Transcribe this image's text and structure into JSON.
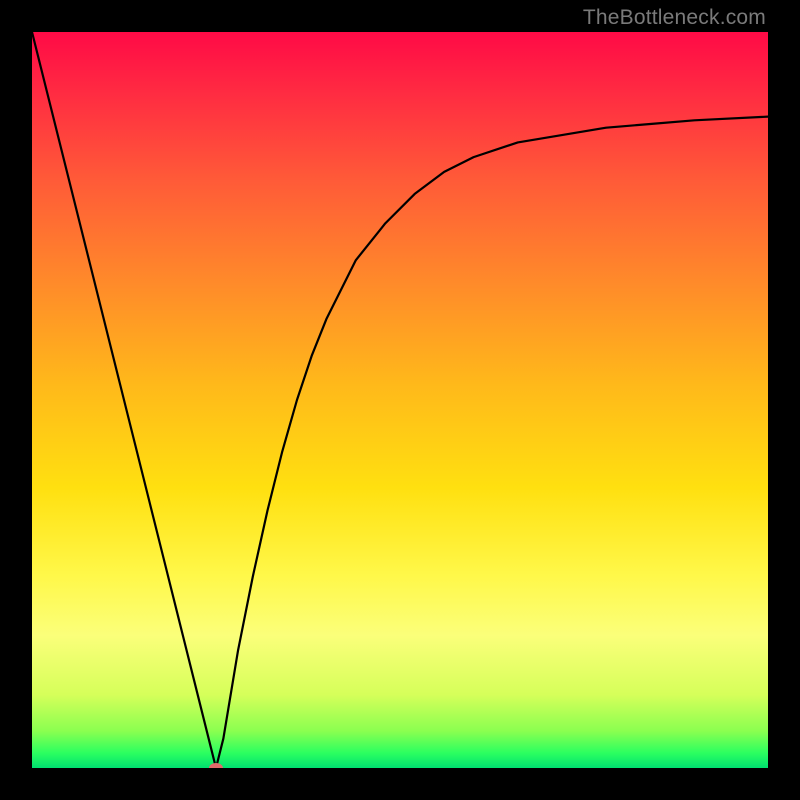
{
  "watermark": "TheBottleneck.com",
  "chart_data": {
    "type": "line",
    "title": "",
    "xlabel": "",
    "ylabel": "",
    "x": [
      0.0,
      0.02,
      0.04,
      0.06,
      0.08,
      0.1,
      0.12,
      0.14,
      0.16,
      0.18,
      0.2,
      0.22,
      0.24,
      0.25,
      0.26,
      0.28,
      0.3,
      0.32,
      0.34,
      0.36,
      0.38,
      0.4,
      0.44,
      0.48,
      0.52,
      0.56,
      0.6,
      0.66,
      0.72,
      0.78,
      0.84,
      0.9,
      1.0
    ],
    "y": [
      1.0,
      0.92,
      0.84,
      0.76,
      0.68,
      0.6,
      0.52,
      0.44,
      0.36,
      0.28,
      0.2,
      0.12,
      0.04,
      0.0,
      0.04,
      0.16,
      0.26,
      0.35,
      0.43,
      0.5,
      0.56,
      0.61,
      0.69,
      0.74,
      0.78,
      0.81,
      0.83,
      0.85,
      0.86,
      0.87,
      0.875,
      0.88,
      0.885
    ],
    "xlim": [
      0,
      1
    ],
    "ylim": [
      0,
      1
    ],
    "marker": {
      "x": 0.25,
      "y": 0.0,
      "color": "#e06a6a"
    }
  }
}
